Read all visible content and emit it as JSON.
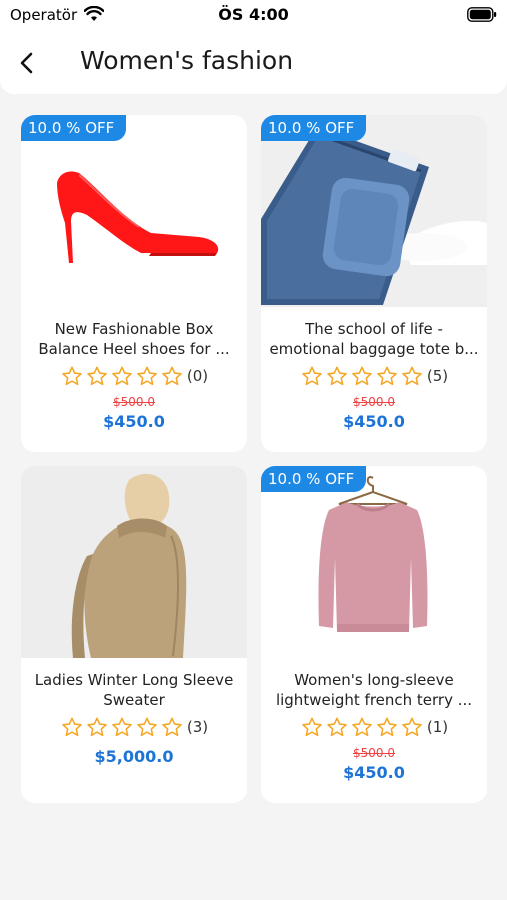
{
  "status_bar": {
    "carrier": "Operatör",
    "time": "ÖS 4:00"
  },
  "header": {
    "title": "Women's fashion",
    "back_icon": "chevron-left-icon"
  },
  "products": [
    {
      "discount": "10.0 % OFF",
      "name_line1": "New Fashionable Box",
      "name_line2": "Balance Heel shoes for ...",
      "rating_count": "(0)",
      "old_price": "$500.0",
      "price": "$450.0",
      "image": "red-heel-shoe"
    },
    {
      "discount": "10.0 % OFF",
      "name_line1": "The school of life -",
      "name_line2": "emotional baggage tote b...",
      "rating_count": "(5)",
      "old_price": "$500.0",
      "price": "$450.0",
      "image": "denim-wallet"
    },
    {
      "name_line1": "Ladies Winter Long Sleeve",
      "name_line2": "Sweater",
      "rating_count": "(3)",
      "price": "$5,000.0",
      "image": "beige-sweater-woman"
    },
    {
      "discount": "10.0 % OFF",
      "name_line1": "Women's long-sleeve",
      "name_line2": "lightweight french terry ...",
      "rating_count": "(1)",
      "old_price": "$500.0",
      "price": "$450.0",
      "image": "pink-sweatshirt-hanger"
    }
  ],
  "colors": {
    "accent": "#1e88e5",
    "price": "#1e74d6",
    "old_price": "#e44444",
    "star": "#f5a623"
  }
}
